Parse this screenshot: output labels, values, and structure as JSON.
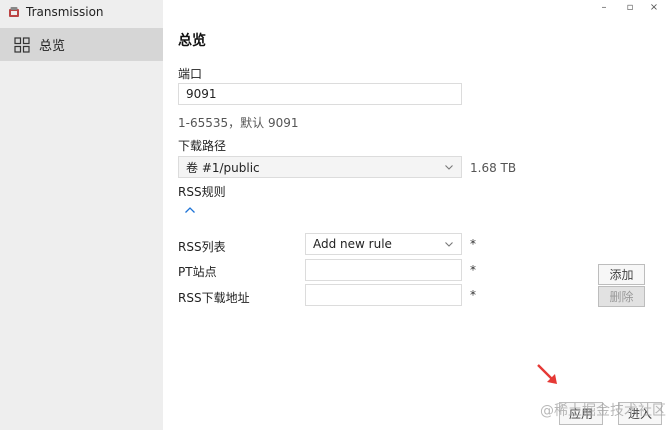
{
  "app": {
    "title": "Transmission"
  },
  "sidebar": {
    "items": [
      {
        "label": "总览"
      }
    ]
  },
  "main": {
    "title": "总览",
    "port": {
      "label": "端口",
      "value": "9091",
      "hint": "1-65535，默认 9091"
    },
    "download_path": {
      "label": "下载路径",
      "value": "卷 #1/public",
      "free_space": "1.68 TB"
    },
    "rss": {
      "label": "RSS规则",
      "list_label": "RSS列表",
      "list_value": "Add new rule",
      "site_label": "PT站点",
      "site_value": "",
      "url_label": "RSS下载地址",
      "url_value": "",
      "required_mark": "*",
      "add_button": "添加",
      "delete_button": "删除"
    },
    "footer": {
      "apply_button": "应用",
      "enter_button": "进入"
    }
  },
  "watermark": "@稀土掘金技术社区",
  "colors": {
    "accent": "#1e73d6",
    "arrow": "#e53935"
  }
}
